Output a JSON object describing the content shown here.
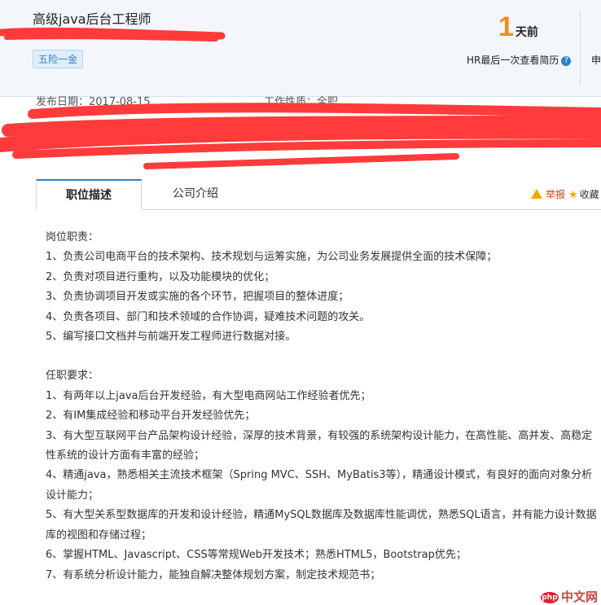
{
  "header": {
    "job_title": "高级java后台工程师",
    "welfare_tag": "五险一金",
    "days_number": "1",
    "days_unit": "天前",
    "hr_text": "HR最后一次查看简历",
    "help_symbol": "?",
    "apply_partial": "申"
  },
  "meta": {
    "publish_partial": "发布日期：2017-08-15",
    "nature_partial": "工作性质：全职"
  },
  "tabs": {
    "active": "职位描述",
    "second": "公司介绍",
    "report": "举报",
    "collect": "收藏"
  },
  "duties": {
    "heading": "岗位职责：",
    "items": [
      "1、负责公司电商平台的技术架构、技术规划与运筹实施，为公司业务发展提供全面的技术保障；",
      "2、负责对项目进行重构，以及功能模块的优化；",
      "3、负责协调项目开发或实施的各个环节，把握项目的整体进度；",
      "4、负责各项目、部门和技术领域的合作协调，疑难技术问题的攻关。",
      "5、编写接口文档并与前端开发工程师进行数据对接。"
    ]
  },
  "requirements": {
    "heading": "任职要求：",
    "items": [
      "1、有两年以上java后台开发经验，有大型电商网站工作经验者优先；",
      "2、有IM集成经验和移动平台开发经验优先；",
      "3、有大型互联网平台产品架构设计经验，深厚的技术背景，有较强的系统架构设计能力，在高性能、高并发、高稳定性系统的设计方面有丰富的经验；",
      "4、精通java，熟悉相关主流技术框架（Spring MVC、SSH、MyBatis3等），精通设计模式，有良好的面向对象分析设计能力；",
      "5、有大型关系型数据库的开发和设计经验，精通MySQL数据库及数据库性能调优，熟悉SQL语言，并有能力设计数据库的视图和存储过程；",
      "6、掌握HTML、Javascript、CSS等常规Web开发技术；熟悉HTML5，Bootstrap优先；",
      "7、有系统分析设计能力，能独自解决整体规划方案，制定技术规范书；"
    ]
  },
  "watermark": {
    "badge": "php",
    "text": "中文网"
  }
}
